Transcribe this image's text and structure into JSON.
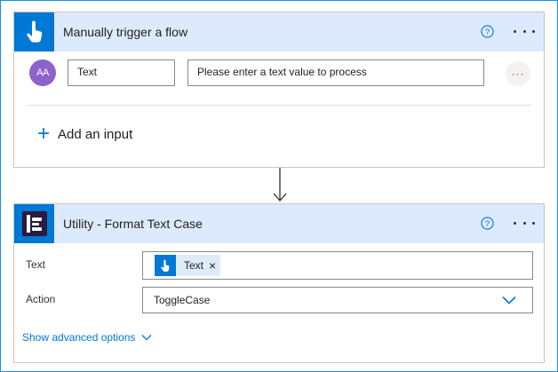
{
  "trigger": {
    "title": "Manually trigger a flow",
    "input_name": "Text",
    "input_description": "Please enter a text value to process",
    "avatar_text": "AA",
    "row_menu": "···",
    "add_input_label": "Add an input",
    "add_input_icon": "+",
    "header_color": "#ddeafe",
    "icon_color": "#0078d4"
  },
  "utility": {
    "title": "Utility - Format Text Case",
    "fields": {
      "text_label": "Text",
      "text_token": "Text",
      "token_remove": "×",
      "action_label": "Action",
      "action_value": "ToggleCase"
    },
    "advanced_label": "Show advanced options"
  },
  "colors": {
    "accent": "#0078d4",
    "avatar": "#8e62cc",
    "border": "#c8c6c4"
  },
  "icons": [
    "hand-pointer-icon",
    "help-icon",
    "more-icon",
    "utility-icon",
    "chevron-down-icon",
    "plus-icon",
    "arrow-down-icon"
  ]
}
